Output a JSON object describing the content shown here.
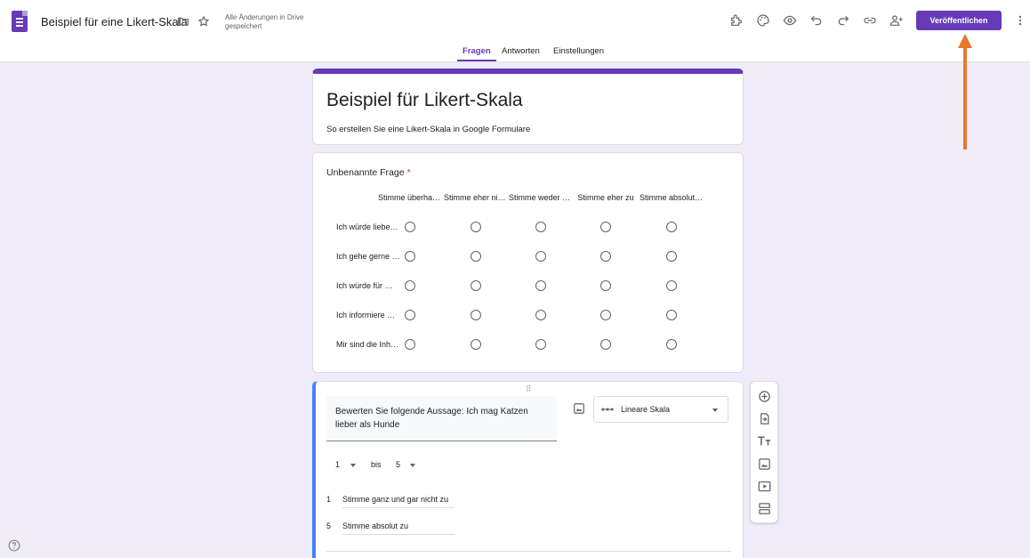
{
  "header": {
    "doc_title": "Beispiel für eine Likert-Skala",
    "save_status_line1": "Alle Änderungen in Drive",
    "save_status_line2": "gespeichert",
    "publish_label": "Veröffentlichen",
    "app_icon": "google-forms-icon",
    "icons": [
      "folder-icon",
      "star-icon",
      "addon-puzzle-icon",
      "palette-icon",
      "preview-eye-icon",
      "undo-icon",
      "redo-icon",
      "link-icon",
      "add-collaborator-icon",
      "more-vert-icon"
    ]
  },
  "tabs": [
    {
      "label": "Fragen",
      "active": true
    },
    {
      "label": "Antworten",
      "active": false
    },
    {
      "label": "Einstellungen",
      "active": false
    }
  ],
  "form": {
    "title": "Beispiel für Likert-Skala",
    "description": "So erstellen Sie eine Likert-Skala in Google Formulare"
  },
  "grid_question": {
    "title": "Unbenannte Frage",
    "required_mark": "*",
    "columns": [
      "Stimme überhaupt nicht zu",
      "Stimme eher nicht zu",
      "Stimme weder noch zu",
      "Stimme eher zu",
      "Stimme absolut zu"
    ],
    "rows": [
      "Ich würde lieber…",
      "Ich gehe gerne …",
      "Ich würde für …",
      "Ich informiere …",
      "Mir sind die Inh…"
    ]
  },
  "edit_question": {
    "title": "Bewerten Sie folgende Aussage: Ich mag Katzen lieber als Hunde",
    "drag_handle": "⠿",
    "type_label": "Lineare Skala",
    "scale_from": "1",
    "scale_to_label": "bis",
    "scale_to": "5",
    "label_min_num": "1",
    "label_min": "Stimme ganz und gar nicht zu",
    "label_max_num": "5",
    "label_max": "Stimme absolut zu"
  },
  "side_toolbar": [
    "add-question-icon",
    "import-questions-icon",
    "add-title-icon",
    "add-image-icon",
    "add-video-icon",
    "add-section-icon"
  ],
  "footer": {
    "help_icon": "help-icon"
  },
  "annotation": {
    "arrow_color": "#e8762f"
  },
  "colors": {
    "accent": "#673ab7",
    "active_border": "#4285f4",
    "background": "#f0ebf8"
  }
}
